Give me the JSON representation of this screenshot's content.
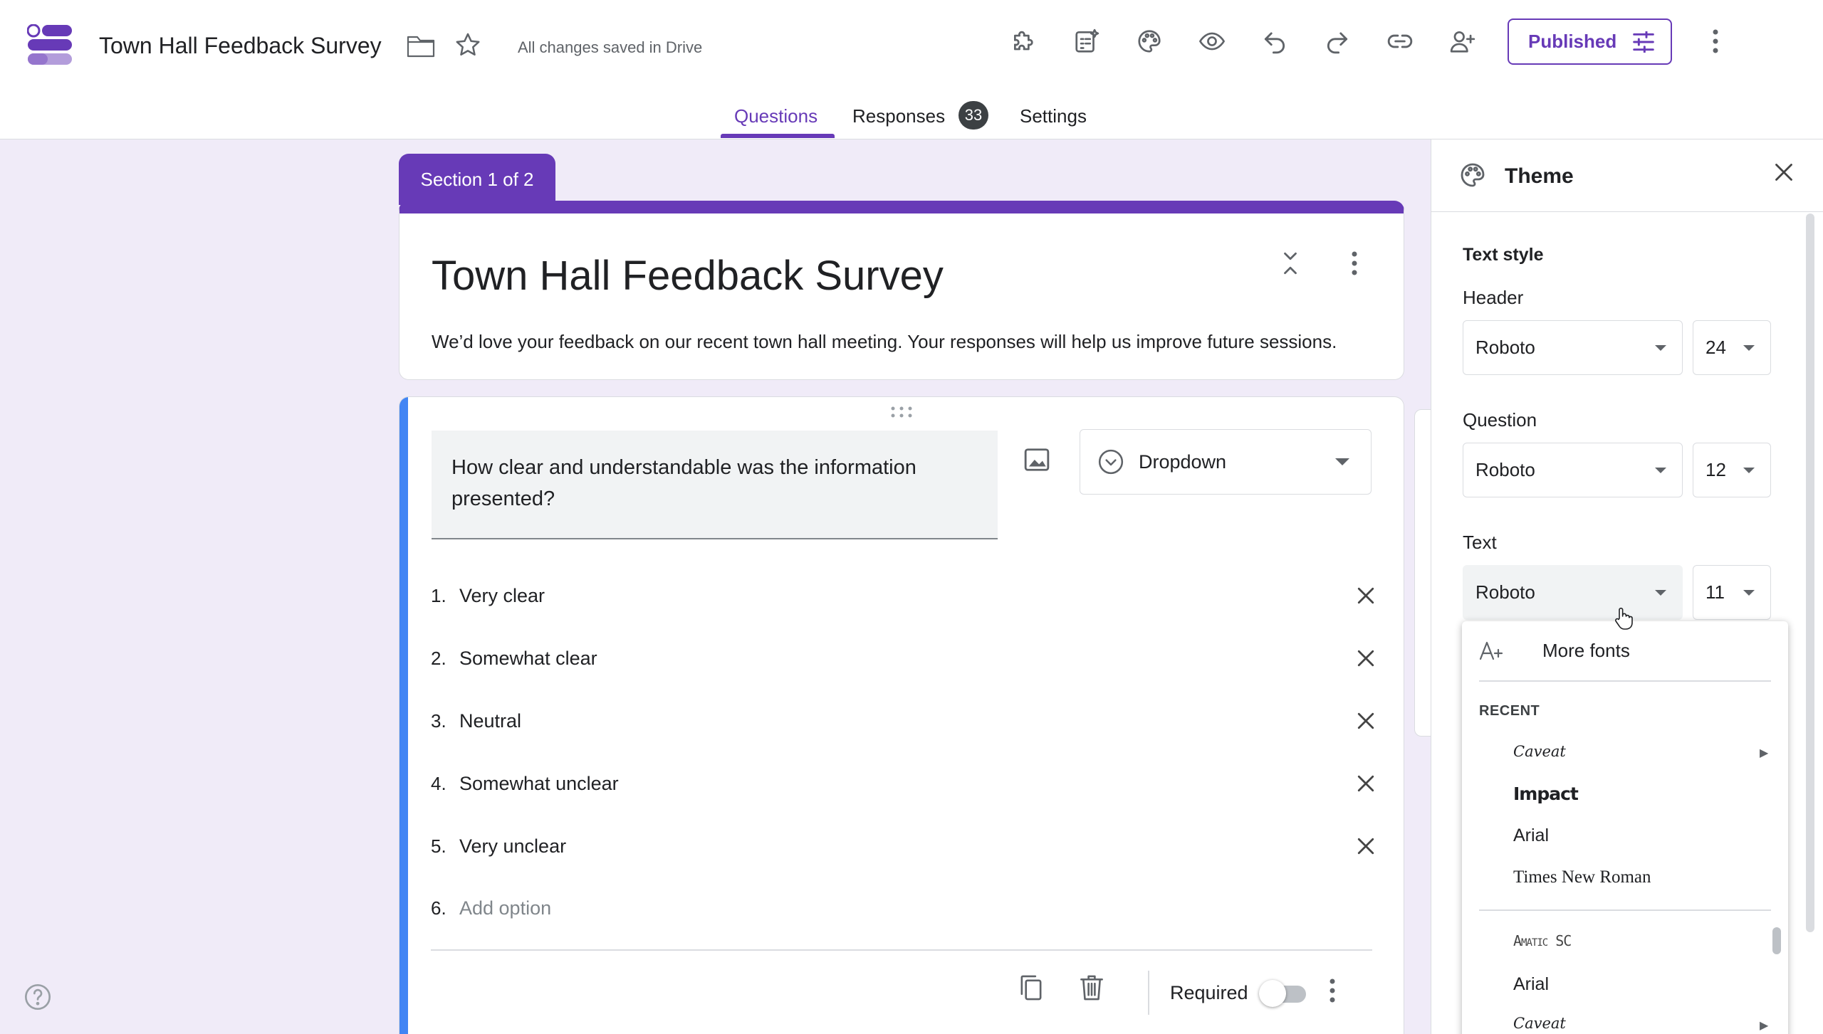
{
  "header": {
    "title": "Town Hall Feedback Survey",
    "save_status": "All changes saved in Drive",
    "publish_label": "Published"
  },
  "tabs": {
    "questions": "Questions",
    "responses": "Responses",
    "responses_count": "33",
    "settings": "Settings"
  },
  "form": {
    "section_label": "Section 1 of 2",
    "title": "Town Hall Feedback Survey",
    "description": "We’d love your feedback on our recent town hall meeting. Your responses will help us improve future sessions."
  },
  "question": {
    "title": "How clear and understandable was the information presented?",
    "type": "Dropdown",
    "options": [
      {
        "num": "1.",
        "text": "Very clear"
      },
      {
        "num": "2.",
        "text": "Somewhat clear"
      },
      {
        "num": "3.",
        "text": "Neutral"
      },
      {
        "num": "4.",
        "text": "Somewhat unclear"
      },
      {
        "num": "5.",
        "text": "Very unclear"
      }
    ],
    "add_option_num": "6.",
    "add_option_label": "Add option",
    "required_label": "Required",
    "required": false
  },
  "theme": {
    "title": "Theme",
    "text_style_heading": "Text style",
    "header_label": "Header",
    "header_font": "Roboto",
    "header_size": "24",
    "question_label": "Question",
    "question_font": "Roboto",
    "question_size": "12",
    "text_label": "Text",
    "text_font": "Roboto",
    "text_size": "11"
  },
  "font_menu": {
    "more_fonts": "More fonts",
    "recent_heading": "RECENT",
    "recent": [
      "Caveat",
      "Impact",
      "Arial",
      "Times New Roman"
    ],
    "all": [
      "Amatic SC",
      "Arial",
      "Caveat"
    ]
  },
  "colors": {
    "accent": "#673ab7",
    "question_accent": "#4285f4",
    "background": "#f0ebf8"
  }
}
